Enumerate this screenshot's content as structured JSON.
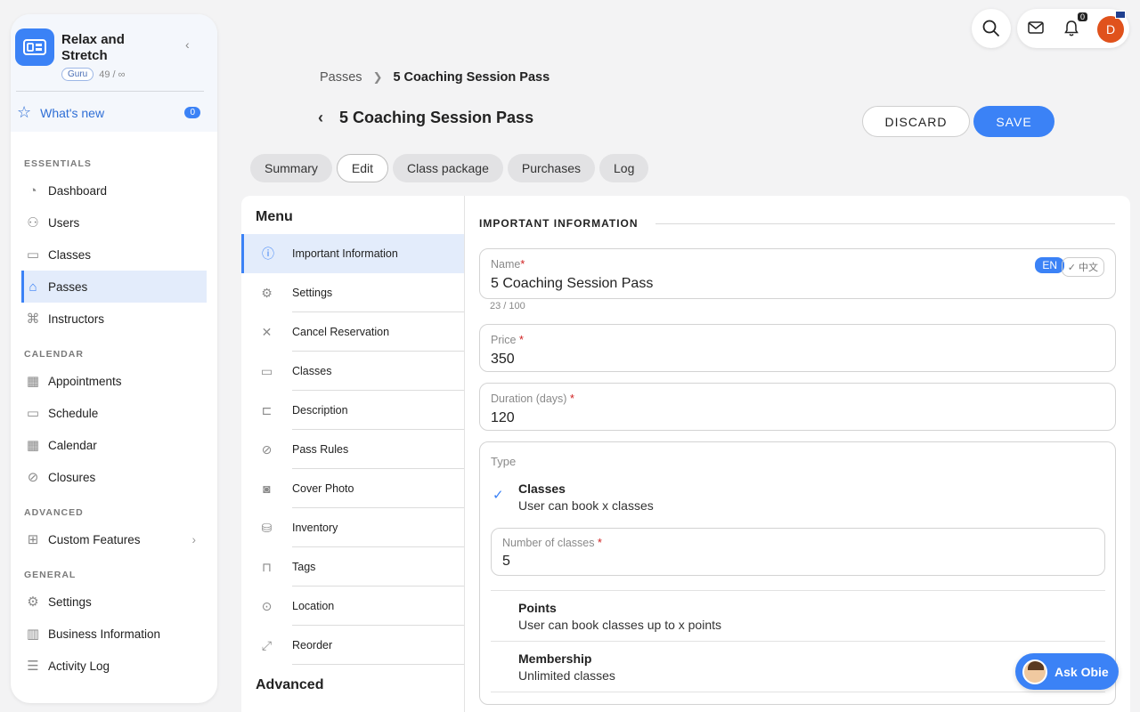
{
  "brand": {
    "name": "Relax and Stretch",
    "plan_badge": "Guru",
    "usage": "49 / ∞"
  },
  "whats_new": {
    "label": "What's new",
    "count": "0"
  },
  "sidebar": {
    "sections": [
      {
        "heading": "ESSENTIALS",
        "items": [
          {
            "label": "Dashboard",
            "icon": "dashboard-icon"
          },
          {
            "label": "Users",
            "icon": "users-icon"
          },
          {
            "label": "Classes",
            "icon": "classes-icon"
          },
          {
            "label": "Passes",
            "icon": "tag-icon",
            "active": true
          },
          {
            "label": "Instructors",
            "icon": "graduation-cap-icon"
          }
        ]
      },
      {
        "heading": "CALENDAR",
        "items": [
          {
            "label": "Appointments",
            "icon": "calendar-31-icon"
          },
          {
            "label": "Schedule",
            "icon": "calendar-icon"
          },
          {
            "label": "Calendar",
            "icon": "calendar-grid-icon"
          },
          {
            "label": "Closures",
            "icon": "ban-icon"
          }
        ]
      },
      {
        "heading": "ADVANCED",
        "items": [
          {
            "label": "Custom Features",
            "icon": "gift-icon",
            "chevron": true
          }
        ]
      },
      {
        "heading": "GENERAL",
        "items": [
          {
            "label": "Settings",
            "icon": "gear-icon"
          },
          {
            "label": "Business Information",
            "icon": "building-icon"
          },
          {
            "label": "Activity Log",
            "icon": "list-icon"
          }
        ]
      }
    ]
  },
  "topbar": {
    "notification_count": "0",
    "avatar_initial": "D"
  },
  "breadcrumb": {
    "parent": "Passes",
    "current": "5 Coaching Session Pass"
  },
  "page": {
    "title": "5 Coaching Session Pass"
  },
  "actions": {
    "discard": "DISCARD",
    "save": "SAVE"
  },
  "tabs": [
    "Summary",
    "Edit",
    "Class package",
    "Purchases",
    "Log"
  ],
  "active_tab": "Edit",
  "menu": {
    "title": "Menu",
    "items": [
      {
        "label": "Important Information",
        "icon": "info-icon",
        "active": true
      },
      {
        "label": "Settings",
        "icon": "gear-icon"
      },
      {
        "label": "Cancel Reservation",
        "icon": "close-icon"
      },
      {
        "label": "Classes",
        "icon": "easel-icon"
      },
      {
        "label": "Description",
        "icon": "book-icon"
      },
      {
        "label": "Pass Rules",
        "icon": "ban-icon"
      },
      {
        "label": "Cover Photo",
        "icon": "camera-icon"
      },
      {
        "label": "Inventory",
        "icon": "database-icon"
      },
      {
        "label": "Tags",
        "icon": "bookmark-icon"
      },
      {
        "label": "Location",
        "icon": "pin-icon"
      },
      {
        "label": "Reorder",
        "icon": "resize-icon"
      }
    ],
    "advanced_heading": "Advanced"
  },
  "form": {
    "section_title": "IMPORTANT INFORMATION",
    "name": {
      "label": "Name",
      "value": "5 Coaching Session Pass",
      "counter": "23 / 100",
      "lang_active": "EN",
      "lang_other": "✓ 中文"
    },
    "price": {
      "label": "Price",
      "value": "350"
    },
    "duration": {
      "label": "Duration (days)",
      "value": "120"
    },
    "type": {
      "label": "Type",
      "options": [
        {
          "title": "Classes",
          "desc": "User can book x classes",
          "selected": true
        },
        {
          "title": "Points",
          "desc": "User can book classes up to x points"
        },
        {
          "title": "Membership",
          "desc": "Unlimited classes"
        }
      ],
      "num_classes": {
        "label": "Number of classes",
        "value": "5"
      }
    }
  },
  "assistant": {
    "label": "Ask Obie"
  },
  "colors": {
    "accent": "#3b82f6",
    "avatar": "#e0521c",
    "required": "#d02020"
  }
}
